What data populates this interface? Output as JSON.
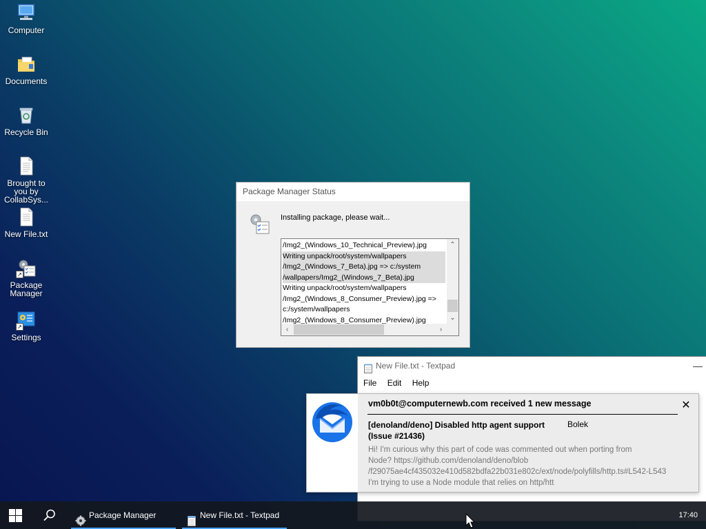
{
  "desktop": {
    "icons": [
      {
        "label": "Computer",
        "icon": "computer-icon"
      },
      {
        "label": "Documents",
        "icon": "documents-folder-icon"
      },
      {
        "label": "Recycle Bin",
        "icon": "recycle-bin-icon"
      },
      {
        "label": "Brought to you by CollabSys...",
        "icon": "text-file-icon"
      },
      {
        "label": "New File.txt",
        "icon": "text-file-icon"
      },
      {
        "label": "Package Manager",
        "icon": "package-manager-icon"
      },
      {
        "label": "Settings",
        "icon": "settings-icon"
      }
    ]
  },
  "package_manager": {
    "title": "Package Manager Status",
    "message": "Installing package, please wait...",
    "log_lines": [
      "/Img2_(Windows_10_Technical_Preview).jpg",
      "Writing unpack/root/system/wallpapers",
      "/Img2_(Windows_7_Beta).jpg => c:/system",
      "/wallpapers/Img2_(Windows_7_Beta).jpg",
      "Writing unpack/root/system/wallpapers",
      "/Img2_(Windows_8_Consumer_Preview).jpg =>",
      "c:/system/wallpapers",
      "/Img2_(Windows_8_Consumer_Preview).jpg"
    ]
  },
  "textpad": {
    "title": "New File.txt - Textpad",
    "menu": [
      "File",
      "Edit",
      "Help"
    ]
  },
  "notification": {
    "title": "vm0b0t@computernewb.com received 1 new message",
    "subject": "[denoland/deno] Disabled http agent support (Issue #21436)",
    "sender": "Bolek",
    "body": [
      "Hi! I'm curious why this part of code was commented out when porting from",
      "Node? https://github.com/denoland/deno/blob",
      "/f29075ae4cf435032e410d582bdfa22b031e802c/ext/node/polyfills/http.ts#L542-L543",
      "I'm trying to use a Node module that relies on http/htt"
    ]
  },
  "taskbar": {
    "items": [
      {
        "label": "Package Manager",
        "icon": "package-manager-icon"
      },
      {
        "label": "New File.txt - Textpad",
        "icon": "notepad-icon"
      }
    ],
    "clock": "17:40",
    "accent": "#4aa3ff"
  }
}
